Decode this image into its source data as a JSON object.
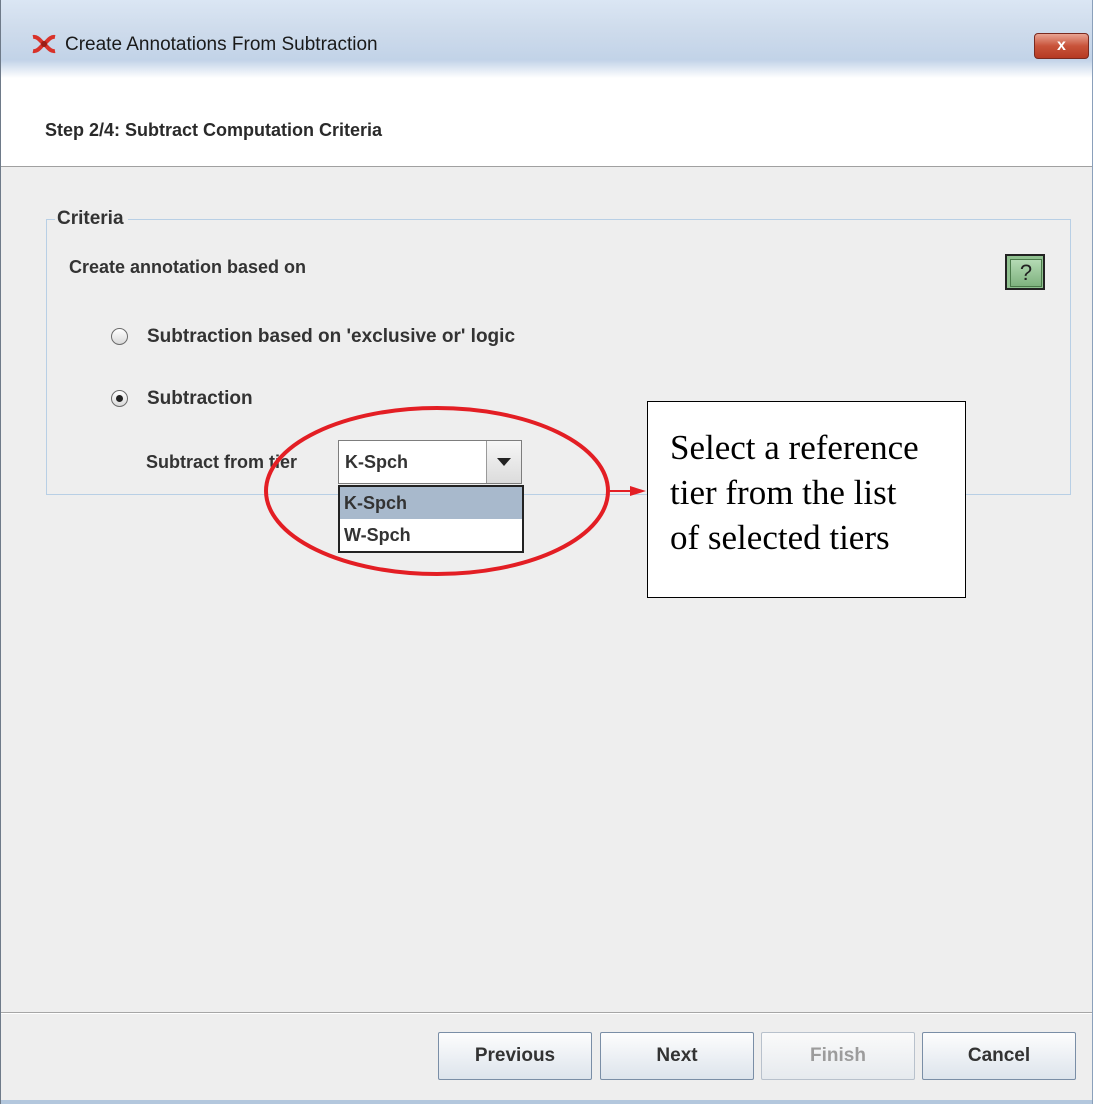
{
  "window": {
    "title": "Create Annotations From Subtraction",
    "close_glyph": "x",
    "icon": "elan-icon"
  },
  "header": {
    "step_title": "Step 2/4: Subtract Computation Criteria"
  },
  "criteria": {
    "legend": "Criteria",
    "create_label": "Create annotation based on",
    "help_glyph": "?",
    "options": [
      {
        "label": "Subtraction based on 'exclusive or' logic",
        "checked": false
      },
      {
        "label": "Subtraction",
        "checked": true
      }
    ],
    "subtract_from_tier_label": "Subtract from tier",
    "tier_combo": {
      "selected": "K-Spch",
      "options": [
        "K-Spch",
        "W-Spch"
      ]
    }
  },
  "footer": {
    "previous_label": "Previous",
    "next_label": "Next",
    "finish_label": "Finish",
    "cancel_label": "Cancel"
  },
  "annotation": {
    "callout_lines": [
      "Select a reference",
      "tier from the list",
      "of selected tiers"
    ],
    "ellipse_color": "#e31e24",
    "arrow_color": "#e31e24"
  }
}
